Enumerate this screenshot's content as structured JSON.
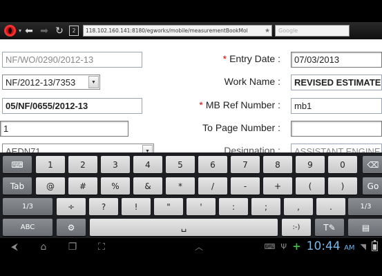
{
  "browser": {
    "url": "118.102.160.141:8180/egworks/mobile/measurementBookMol",
    "search_placeholder": "Google",
    "tab_count": "2"
  },
  "form": {
    "wo_number": "NF/WO/0290/2012-13",
    "estimate_select": "NF/2012-13/7353",
    "mb_number": "05/NF/0655/2012-13",
    "page_from": "1",
    "partial_field": "AEDN71",
    "entry_date_label": "Entry Date :",
    "entry_date_value": "07/03/2013",
    "work_name_label": "Work Name :",
    "work_name_value": "REVISED ESTIMATE",
    "mb_ref_label": "MB Ref Number :",
    "mb_ref_value": "mb1",
    "to_page_label": "To Page Number :",
    "to_page_value": "",
    "designation_label": "Designation :",
    "designation_value": "ASSISTANT ENGINE",
    "required_mark": "*"
  },
  "keyboard": {
    "row1": [
      "1",
      "2",
      "3",
      "4",
      "5",
      "6",
      "7",
      "8",
      "9",
      "0"
    ],
    "row2": [
      "@",
      "#",
      "%",
      "&",
      "*",
      "/",
      "-",
      "+",
      "(",
      ")"
    ],
    "row3": [
      "÷",
      "?",
      "!",
      "\"",
      "'",
      ":",
      ";",
      ",",
      "."
    ],
    "tab_label": "Tab",
    "page_label": "1/3",
    "abc_label": "ABC",
    "smiley": ":-)",
    "go_label": "Go"
  },
  "system": {
    "time": "10:44",
    "ampm": "AM"
  }
}
